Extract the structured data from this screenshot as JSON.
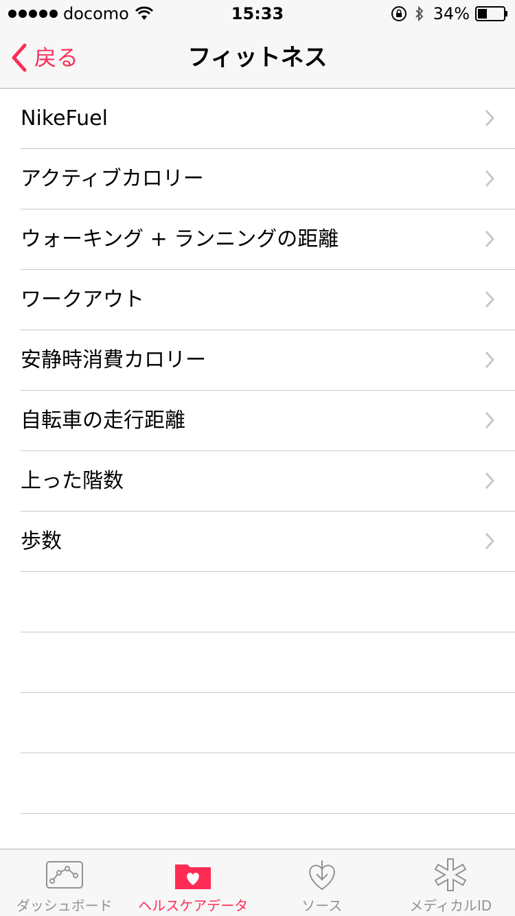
{
  "status_bar": {
    "carrier": "docomo",
    "time": "15:33",
    "battery": "34%"
  },
  "nav": {
    "back_label": "戻る",
    "title": "フィットネス"
  },
  "list": {
    "items": [
      {
        "label": "NikeFuel"
      },
      {
        "label": "アクティブカロリー"
      },
      {
        "label": "ウォーキング + ランニングの距離"
      },
      {
        "label": "ワークアウト"
      },
      {
        "label": "安静時消費カロリー"
      },
      {
        "label": "自転車の走行距離"
      },
      {
        "label": "上った階数"
      },
      {
        "label": "歩数"
      }
    ]
  },
  "tab_bar": {
    "tabs": [
      {
        "label": "ダッシュボード",
        "icon": "dashboard-icon"
      },
      {
        "label": "ヘルスケアデータ",
        "icon": "health-data-icon",
        "active": true
      },
      {
        "label": "ソース",
        "icon": "sources-icon"
      },
      {
        "label": "メディカルID",
        "icon": "medical-id-icon"
      }
    ]
  },
  "colors": {
    "accent": "#fe2c55",
    "inactive": "#929292",
    "separator": "#c8c7cc",
    "bar_background": "#f7f7f8"
  }
}
